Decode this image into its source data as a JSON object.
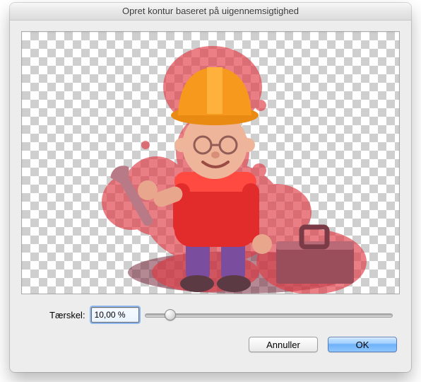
{
  "window": {
    "title": "Opret kontur baseret på uigennemsigtighed"
  },
  "threshold": {
    "label": "Tærskel:",
    "value": "10,00 %",
    "slider_percent": 10
  },
  "buttons": {
    "cancel": "Annuller",
    "ok": "OK"
  }
}
